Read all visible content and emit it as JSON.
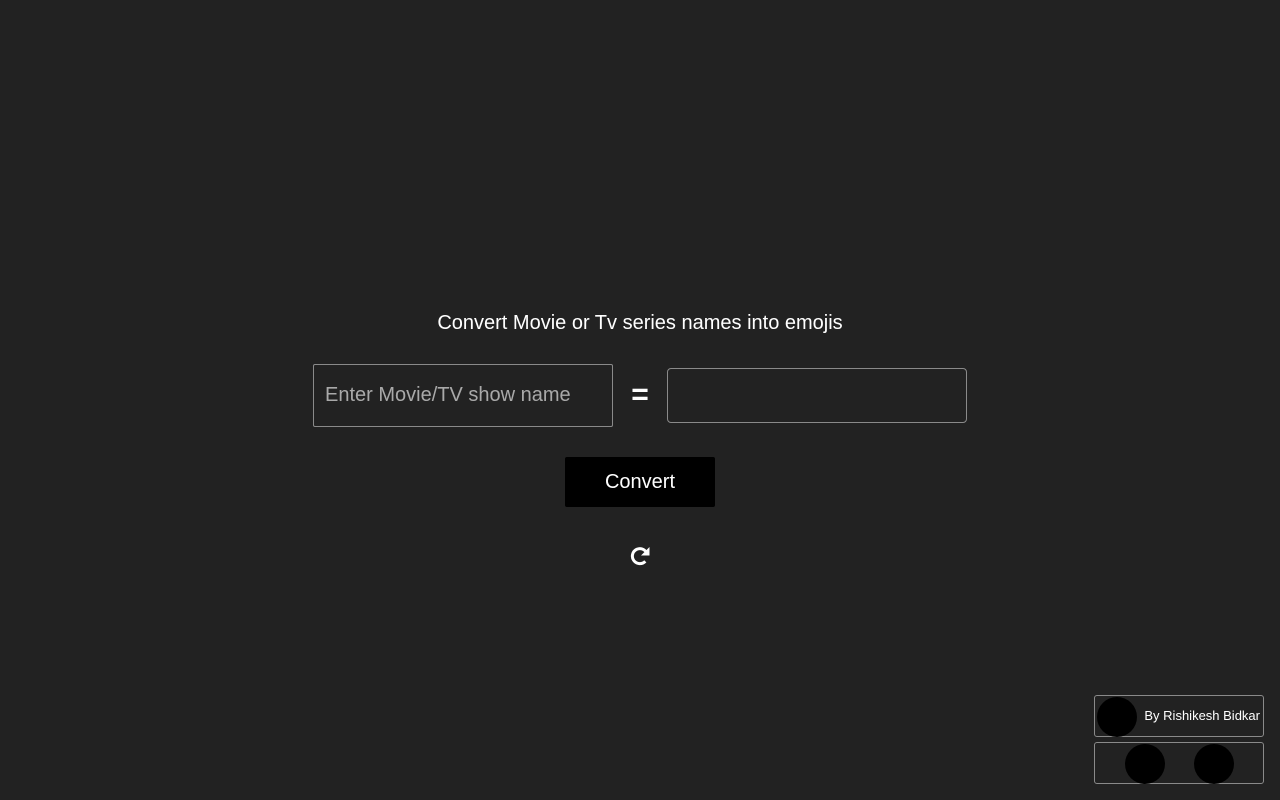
{
  "app": {
    "heading": "Convert Movie or Tv series names into emojis"
  },
  "form": {
    "input_placeholder": "Enter Movie/TV show name",
    "input_value": "",
    "equals_sign": "=",
    "output_value": "",
    "convert_label": "Convert",
    "reset_icon": "refresh-icon"
  },
  "footer": {
    "credit": "By Rishikesh Bidkar",
    "avatar_icon": "avatar",
    "social_icons": [
      "social-link-icon",
      "social-link-icon"
    ]
  }
}
